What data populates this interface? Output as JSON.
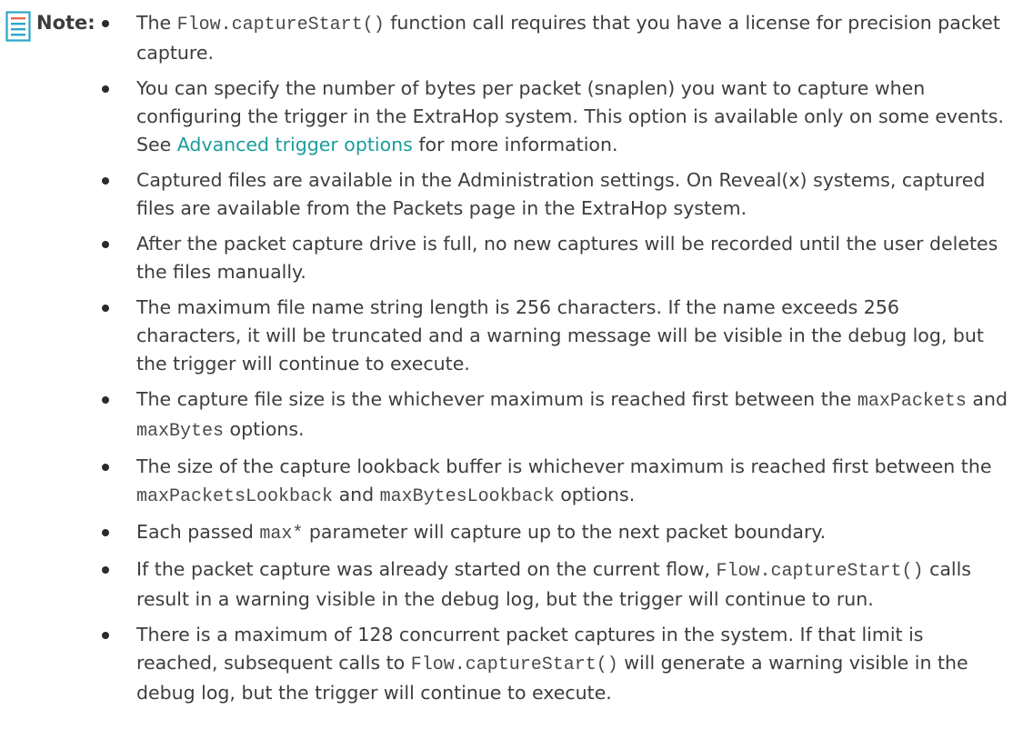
{
  "note": {
    "icon": "note-icon",
    "label": "Note:",
    "icon_color": "#2ba6c8",
    "accent_colors": [
      "#e36a4f",
      "#2ba6c8"
    ],
    "link_color": "#1a9c9c",
    "items": [
      {
        "seg_0": "The ",
        "code_0": "Flow.captureStart()",
        "seg_1": " function call requires that you have a license for precision packet capture."
      },
      {
        "seg_0": "You can specify the number of bytes per packet (snaplen) you want to capture when configuring the trigger in the ExtraHop system. This option is available only on some events. See ",
        "link_0": "Advanced trigger options",
        "seg_1": " for more information."
      },
      {
        "seg_0": "Captured files are available in the Administration settings. On Reveal(x) systems, captured files are available from the Packets page in the ExtraHop system."
      },
      {
        "seg_0": "After the packet capture drive is full, no new captures will be recorded until the user deletes the files manually."
      },
      {
        "seg_0": "The maximum file name string length is 256 characters. If the name exceeds 256 characters, it will be truncated and a warning message will be visible in the debug log, but the trigger will continue to execute."
      },
      {
        "seg_0": "The capture file size is the whichever maximum is reached first between the ",
        "code_0": "maxPackets",
        "seg_1": " and ",
        "code_1": "maxBytes",
        "seg_2": " options."
      },
      {
        "seg_0": "The size of the capture lookback buffer is whichever maximum is reached first between the ",
        "code_0": "maxPacketsLookback",
        "seg_1": " and ",
        "code_1": "maxBytesLookback",
        "seg_2": " options."
      },
      {
        "seg_0": "Each passed ",
        "code_0": "max*",
        "seg_1": " parameter will capture up to the next packet boundary."
      },
      {
        "seg_0": "If the packet capture was already started on the current flow, ",
        "code_0": "Flow.captureStart()",
        "seg_1": " calls result in a warning visible in the debug log, but the trigger will continue to run."
      },
      {
        "seg_0": "There is a maximum of 128 concurrent packet captures in the system. If that limit is reached, subsequent calls to ",
        "code_0": "Flow.captureStart()",
        "seg_1": " will generate a warning visible in the debug log, but the trigger will continue to execute."
      }
    ]
  }
}
